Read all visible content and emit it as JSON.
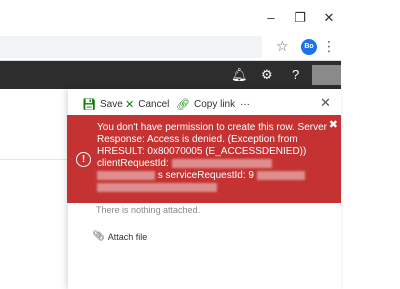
{
  "browser": {
    "window_controls": [
      "–",
      "❐",
      "✕"
    ],
    "avatar_initials": "Bo"
  },
  "panel": {
    "commands": {
      "save": "Save",
      "cancel": "Cancel",
      "copy_link": "Copy link",
      "more": "···"
    },
    "error": {
      "line1": "You don't have permission to create this row. Server",
      "line2": "Response: Access is denied. (Exception from",
      "line3": "HRESULT: 0x80070005 (E_ACCESSDENIED))",
      "line4": "clientRequestId:",
      "line5_label": "s serviceRequestId: 9"
    },
    "attachments": {
      "empty_text": "There is nothing attached.",
      "attach_label": "Attach file"
    }
  },
  "colors": {
    "error_red": "#c43232",
    "header_dark": "#2d2d2d",
    "accent_green": "#107c10"
  }
}
